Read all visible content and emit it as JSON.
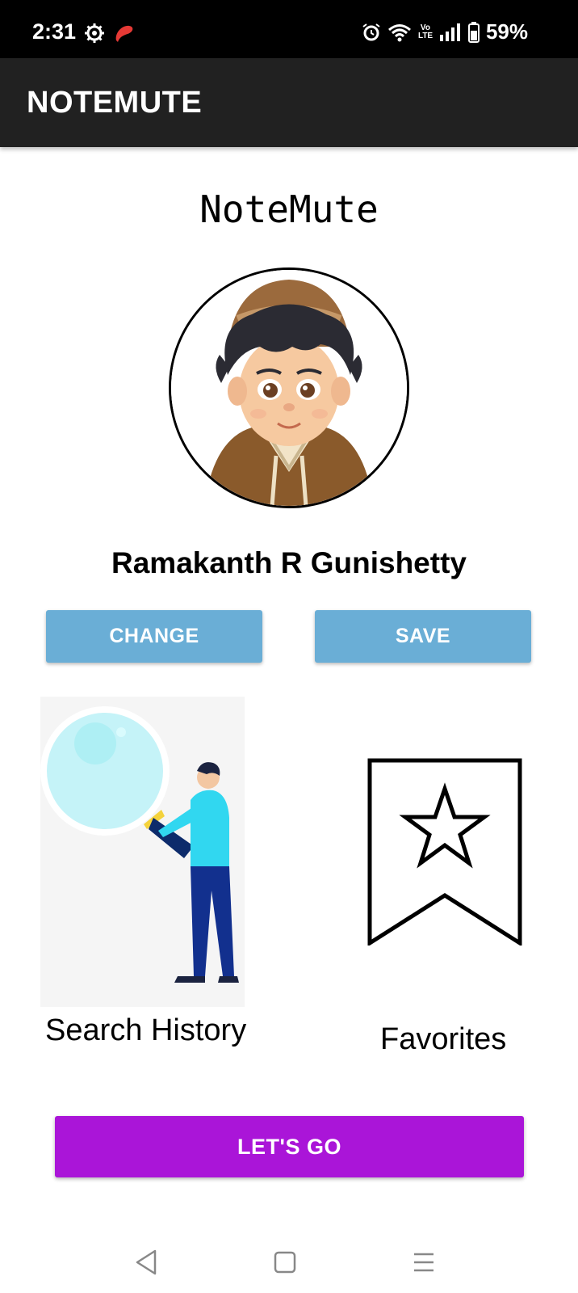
{
  "status_bar": {
    "time": "2:31",
    "battery": "59%",
    "volte": "Vo LTE",
    "icons": [
      "settings-gear-icon",
      "airtel-icon",
      "alarm-icon",
      "wifi-icon",
      "volte-icon",
      "signal-icon",
      "battery-icon"
    ]
  },
  "app_bar": {
    "title": "NOTEMUTE"
  },
  "main": {
    "heading": "NoteMute",
    "user_name": "Ramakanth R Gunishetty",
    "buttons": {
      "change": "CHANGE",
      "save": "SAVE",
      "lets_go": "LET'S GO"
    },
    "tiles": {
      "search_history": "Search History",
      "favorites": "Favorites"
    }
  },
  "colors": {
    "status_bar": "#000000",
    "app_bar": "#212121",
    "secondary_button": "#6aaed6",
    "primary_button": "#aa15d8"
  },
  "nav_bar": {
    "icons": [
      "back-icon",
      "home-icon",
      "recents-icon"
    ]
  }
}
